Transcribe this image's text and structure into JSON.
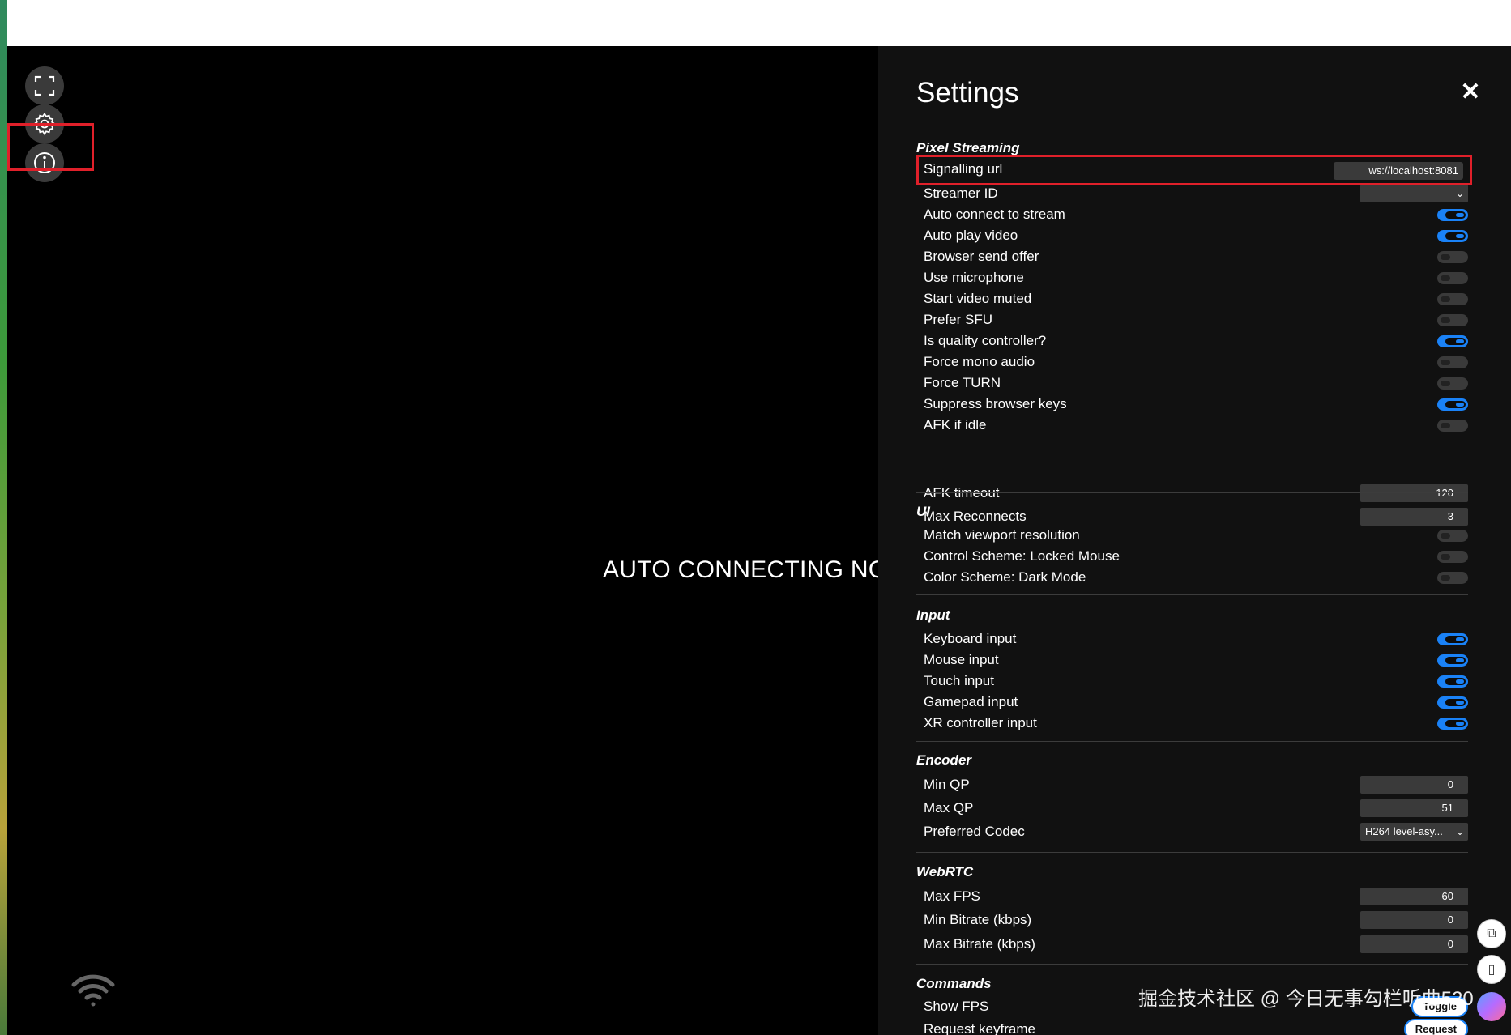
{
  "viewport": {
    "status_text": "AUTO CONNECTING NO"
  },
  "sidebar": {
    "fullscreen_icon": "fullscreen-icon",
    "settings_icon": "gear-icon",
    "info_icon": "info-icon"
  },
  "settings": {
    "title": "Settings",
    "close_label": "✕",
    "sections": {
      "pixel_streaming": {
        "title": "Pixel Streaming",
        "signalling_url_label": "Signalling url",
        "signalling_url_value": "ws://localhost:8081",
        "streamer_id_label": "Streamer ID",
        "streamer_id_value": "",
        "rows": [
          {
            "label": "Auto connect to stream",
            "on": true
          },
          {
            "label": "Auto play video",
            "on": true
          },
          {
            "label": "Browser send offer",
            "on": false
          },
          {
            "label": "Use microphone",
            "on": false
          },
          {
            "label": "Start video muted",
            "on": false
          },
          {
            "label": "Prefer SFU",
            "on": false
          },
          {
            "label": "Is quality controller?",
            "on": true
          },
          {
            "label": "Force mono audio",
            "on": false
          },
          {
            "label": "Force TURN",
            "on": false
          },
          {
            "label": "Suppress browser keys",
            "on": true
          },
          {
            "label": "AFK if idle",
            "on": false
          }
        ],
        "afk_timeout_label": "AFK timeout",
        "afk_timeout_value": "120",
        "max_reconnects_label": "Max Reconnects",
        "max_reconnects_value": "3"
      },
      "ui": {
        "title": "UI",
        "rows": [
          {
            "label": "Match viewport resolution",
            "on": false
          },
          {
            "label": "Control Scheme: Locked Mouse",
            "on": false
          },
          {
            "label": "Color Scheme: Dark Mode",
            "on": false
          }
        ]
      },
      "input": {
        "title": "Input",
        "rows": [
          {
            "label": "Keyboard input",
            "on": true
          },
          {
            "label": "Mouse input",
            "on": true
          },
          {
            "label": "Touch input",
            "on": true
          },
          {
            "label": "Gamepad input",
            "on": true
          },
          {
            "label": "XR controller input",
            "on": true
          }
        ]
      },
      "encoder": {
        "title": "Encoder",
        "min_qp_label": "Min QP",
        "min_qp_value": "0",
        "max_qp_label": "Max QP",
        "max_qp_value": "51",
        "codec_label": "Preferred Codec",
        "codec_value": "H264 level-asy..."
      },
      "webrtc": {
        "title": "WebRTC",
        "max_fps_label": "Max FPS",
        "max_fps_value": "60",
        "min_bitrate_label": "Min Bitrate (kbps)",
        "min_bitrate_value": "0",
        "max_bitrate_label": "Max Bitrate (kbps)",
        "max_bitrate_value": "0"
      },
      "commands": {
        "title": "Commands",
        "show_fps_label": "Show FPS",
        "show_fps_button": "Toggle",
        "keyframe_label": "Request keyframe",
        "keyframe_button": "Request"
      }
    }
  },
  "overlay": {
    "watermark": "掘金技术社区 @ 今日无事勾栏听曲520"
  },
  "colors": {
    "accent": "#1a82f7",
    "highlight": "#e0202a",
    "panel_bg": "#111111"
  }
}
